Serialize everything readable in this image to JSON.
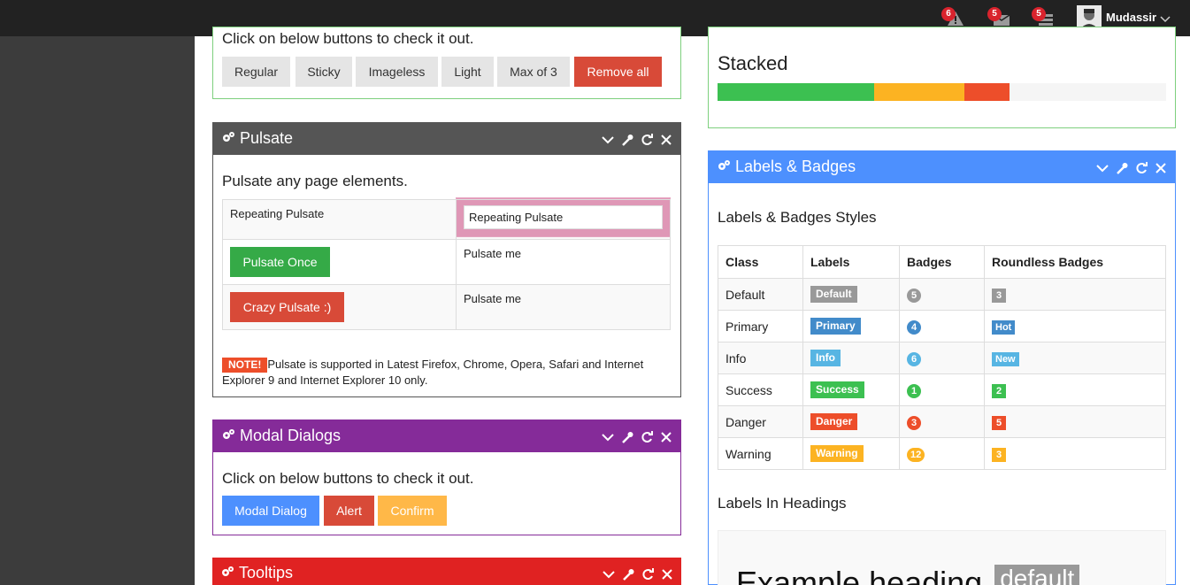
{
  "topbar": {
    "notifications": [
      {
        "icon": "warning-icon",
        "count": "6"
      },
      {
        "icon": "inbox-icon",
        "count": "5"
      },
      {
        "icon": "tasks-icon",
        "count": "5"
      }
    ],
    "user": {
      "name": "Mudassir"
    }
  },
  "notific8_partial": {
    "intro": "Click on below buttons to check it out.",
    "buttons": [
      "Regular",
      "Sticky",
      "Imageless",
      "Light",
      "Max of 3",
      "Remove all"
    ]
  },
  "pulsate": {
    "title": "Pulsate",
    "header_color": "#555555",
    "intro": "Pulsate any page elements.",
    "rows": [
      {
        "left": "Repeating Pulsate",
        "right": "Repeating Pulsate"
      },
      {
        "left_button": "Pulsate Once",
        "right": "Pulsate me"
      },
      {
        "left_button": "Crazy Pulsate :)",
        "right": "Pulsate me"
      }
    ],
    "note_label": "NOTE!",
    "note_text": "Pulsate is supported in Latest Firefox, Chrome, Opera, Safari and Internet Explorer 9 and Internet Explorer 10 only."
  },
  "modal": {
    "title": "Modal Dialogs",
    "header_color": "#852b99",
    "intro": "Click on below buttons to check it out.",
    "buttons": [
      "Modal Dialog",
      "Alert",
      "Confirm"
    ]
  },
  "tooltips": {
    "title": "Tooltips",
    "header_color": "#e02222"
  },
  "stacked": {
    "title": "Stacked",
    "segments": [
      {
        "color": "#3cc051",
        "percent": 35
      },
      {
        "color": "#fcb322",
        "percent": 20
      },
      {
        "color": "#ed4e2a",
        "percent": 10
      }
    ]
  },
  "labels": {
    "title": "Labels & Badges",
    "header_color": "#4d90fe",
    "subtitle": "Labels & Badges Styles",
    "columns": [
      "Class",
      "Labels",
      "Badges",
      "Roundless Badges"
    ],
    "rows": [
      {
        "class": "Default",
        "label": "Default",
        "badge": "5",
        "roundless": "3",
        "color": "#999999"
      },
      {
        "class": "Primary",
        "label": "Primary",
        "badge": "4",
        "roundless": "Hot",
        "color": "#428bca"
      },
      {
        "class": "Info",
        "label": "Info",
        "badge": "6",
        "roundless": "New",
        "color": "#57b5e3"
      },
      {
        "class": "Success",
        "label": "Success",
        "badge": "1",
        "roundless": "2",
        "color": "#3cc051"
      },
      {
        "class": "Danger",
        "label": "Danger",
        "badge": "3",
        "roundless": "5",
        "color": "#ed4e2a"
      },
      {
        "class": "Warning",
        "label": "Warning",
        "badge": "12",
        "roundless": "3",
        "color": "#fcb322"
      }
    ],
    "headings_title": "Labels In Headings",
    "example_heading": "Example heading",
    "example_label": "default"
  }
}
